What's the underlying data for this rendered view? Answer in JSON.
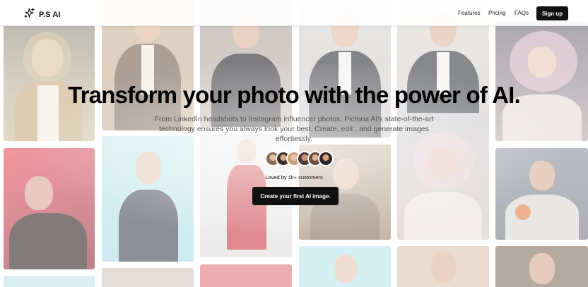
{
  "nav": {
    "logo_text": "P.S AI",
    "links": [
      "Features",
      "Pricing",
      "FAQs"
    ],
    "signup_label": "Sign up"
  },
  "hero": {
    "title": "Transform your photo with the power of AI.",
    "subtitle": "From LinkedIn headshots to Instagram influencer photos, Pictoria AI's state-of-the-art technology ensures you always look your best. Create, edit , and generate images effortlessly.",
    "social_proof": "Loved by 1k+ customers",
    "cta_label": "Create your first AI image."
  },
  "colors": {
    "accent": "#111111",
    "button_text": "#ffffff"
  }
}
